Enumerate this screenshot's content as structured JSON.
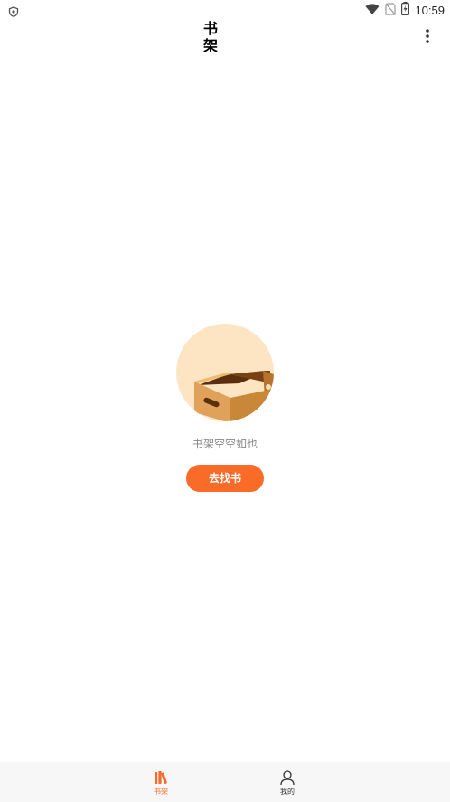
{
  "status_bar": {
    "time": "10:59",
    "icons": [
      "shield-icon",
      "wifi-icon",
      "no-sim-icon",
      "battery-charging-icon"
    ]
  },
  "header": {
    "title": "书架",
    "menu_icon": "more-vert-icon"
  },
  "empty_state": {
    "illustration": "empty-box-icon",
    "message": "书架空空如也",
    "button_label": "去找书"
  },
  "bottom_nav": {
    "items": [
      {
        "label": "书架",
        "icon": "bookshelf-icon",
        "active": true
      },
      {
        "label": "我的",
        "icon": "user-icon",
        "active": false
      }
    ]
  },
  "colors": {
    "accent": "#f96b27",
    "illustration_bg": "#fde5c3",
    "nav_bg": "#f7f7f7",
    "muted_text": "#888888"
  }
}
